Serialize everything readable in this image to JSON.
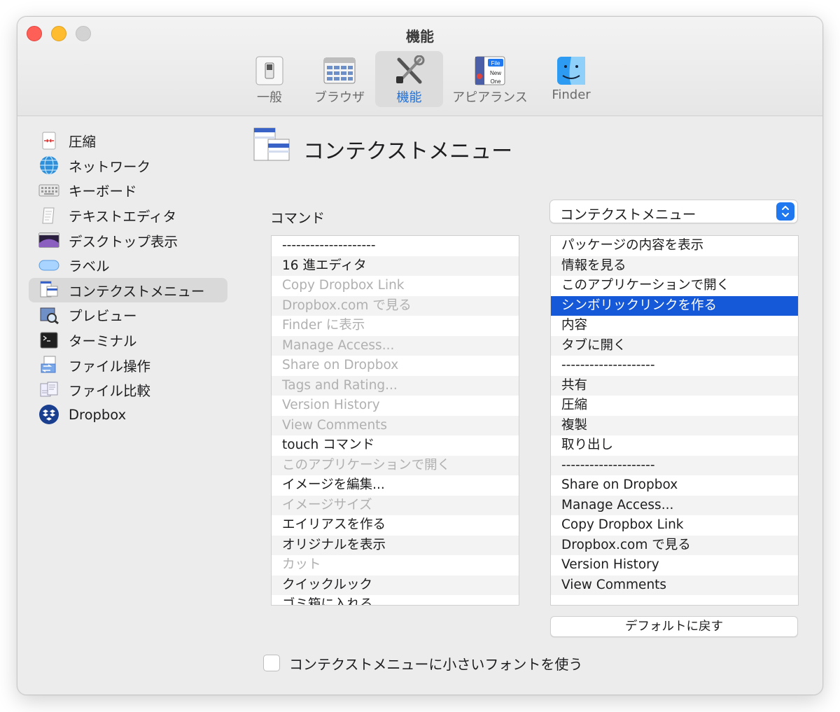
{
  "window": {
    "title": "機能"
  },
  "toolbar": {
    "items": [
      {
        "label": "一般",
        "icon": "switch-icon"
      },
      {
        "label": "ブラウザ",
        "icon": "browser-window-icon"
      },
      {
        "label": "機能",
        "icon": "tools-icon",
        "active": true
      },
      {
        "label": "アピアランス",
        "icon": "appearance-icon"
      },
      {
        "label": "Finder",
        "icon": "finder-icon"
      }
    ]
  },
  "sidebar": {
    "items": [
      {
        "label": "圧縮",
        "icon": "compress-icon"
      },
      {
        "label": "ネットワーク",
        "icon": "network-globe-icon"
      },
      {
        "label": "キーボード",
        "icon": "keyboard-icon"
      },
      {
        "label": "テキストエディタ",
        "icon": "text-editor-icon"
      },
      {
        "label": "デスクトップ表示",
        "icon": "desktop-icon"
      },
      {
        "label": "ラベル",
        "icon": "label-icon"
      },
      {
        "label": "コンテクストメニュー",
        "icon": "context-menu-icon",
        "active": true
      },
      {
        "label": "プレビュー",
        "icon": "preview-icon"
      },
      {
        "label": "ターミナル",
        "icon": "terminal-icon"
      },
      {
        "label": "ファイル操作",
        "icon": "file-operation-icon"
      },
      {
        "label": "ファイル比較",
        "icon": "file-compare-icon"
      },
      {
        "label": "Dropbox",
        "icon": "dropbox-icon"
      }
    ]
  },
  "panel": {
    "title": "コンテクストメニュー",
    "commands_label": "コマンド",
    "menu_select": {
      "value": "コンテクストメニュー"
    },
    "commands": [
      {
        "label": "--------------------",
        "disabled": false
      },
      {
        "label": "16 進エディタ",
        "disabled": false
      },
      {
        "label": "Copy Dropbox Link",
        "disabled": true
      },
      {
        "label": "Dropbox.com で見る",
        "disabled": true
      },
      {
        "label": "Finder に表示",
        "disabled": true
      },
      {
        "label": "Manage Access...",
        "disabled": true
      },
      {
        "label": "Share on Dropbox",
        "disabled": true
      },
      {
        "label": "Tags and Rating...",
        "disabled": true
      },
      {
        "label": "Version History",
        "disabled": true
      },
      {
        "label": "View Comments",
        "disabled": true
      },
      {
        "label": "touch コマンド",
        "disabled": false
      },
      {
        "label": "このアプリケーションで開く",
        "disabled": true
      },
      {
        "label": "イメージを編集...",
        "disabled": false
      },
      {
        "label": "イメージサイズ",
        "disabled": true
      },
      {
        "label": "エイリアスを作る",
        "disabled": false
      },
      {
        "label": "オリジナルを表示",
        "disabled": false
      },
      {
        "label": "カット",
        "disabled": true
      },
      {
        "label": "クイックルック",
        "disabled": false
      },
      {
        "label": "ゴミ箱に入れる",
        "disabled": false
      }
    ],
    "menu_items": [
      {
        "label": "パッケージの内容を表示"
      },
      {
        "label": "情報を見る"
      },
      {
        "label": "このアプリケーションで開く"
      },
      {
        "label": "シンボリックリンクを作る",
        "selected": true
      },
      {
        "label": "内容"
      },
      {
        "label": "タブに開く"
      },
      {
        "label": "--------------------"
      },
      {
        "label": "共有"
      },
      {
        "label": "圧縮"
      },
      {
        "label": "複製"
      },
      {
        "label": "取り出し"
      },
      {
        "label": "--------------------"
      },
      {
        "label": "Share on Dropbox"
      },
      {
        "label": "Manage Access..."
      },
      {
        "label": "Copy Dropbox Link"
      },
      {
        "label": "Dropbox.com で見る"
      },
      {
        "label": "Version History"
      },
      {
        "label": "View Comments"
      }
    ],
    "reset_button": "デフォルトに戻す",
    "small_font_checkbox": {
      "label": "コンテクストメニューに小さいフォントを使う",
      "checked": false
    }
  },
  "colors": {
    "accent": "#1558d8",
    "close": "#fe5f57",
    "minimize": "#febc2e",
    "zoom": "#d3d3d3"
  }
}
